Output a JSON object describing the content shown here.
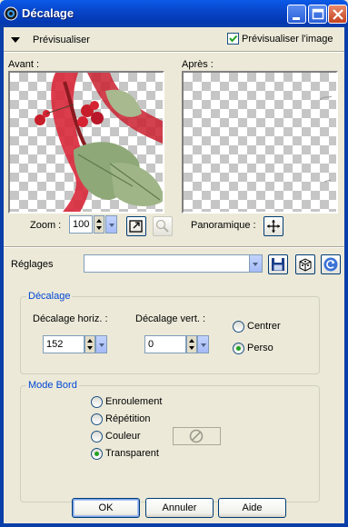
{
  "window": {
    "title": "Décalage"
  },
  "preview": {
    "toggle_label": "Prévisualiser",
    "checkbox_label": "Prévisualiser l'image",
    "checkbox_checked": true,
    "before_label": "Avant :",
    "after_label": "Après :",
    "zoom_label": "Zoom :",
    "zoom_value": "100",
    "pan_label": "Panoramique :"
  },
  "presets": {
    "label": "Réglages",
    "value": ""
  },
  "offset": {
    "group_title": "Décalage",
    "horiz_label": "Décalage horiz. :",
    "horiz_value": "152",
    "vert_label": "Décalage vert. :",
    "vert_value": "0",
    "options": [
      {
        "label": "Centrer",
        "selected": false
      },
      {
        "label": "Perso",
        "selected": true
      }
    ]
  },
  "edge_mode": {
    "group_title": "Mode Bord",
    "options": [
      {
        "label": "Enroulement",
        "selected": false
      },
      {
        "label": "Répétition",
        "selected": false
      },
      {
        "label": "Couleur",
        "selected": false
      },
      {
        "label": "Transparent",
        "selected": true
      }
    ]
  },
  "buttons": {
    "ok": "OK",
    "cancel": "Annuler",
    "help": "Aide"
  },
  "colors": {
    "titlebar": "#0a4fd9",
    "dialog_bg": "#ece9d8",
    "group_title": "#0046d5",
    "radio_dot": "#21a121"
  }
}
